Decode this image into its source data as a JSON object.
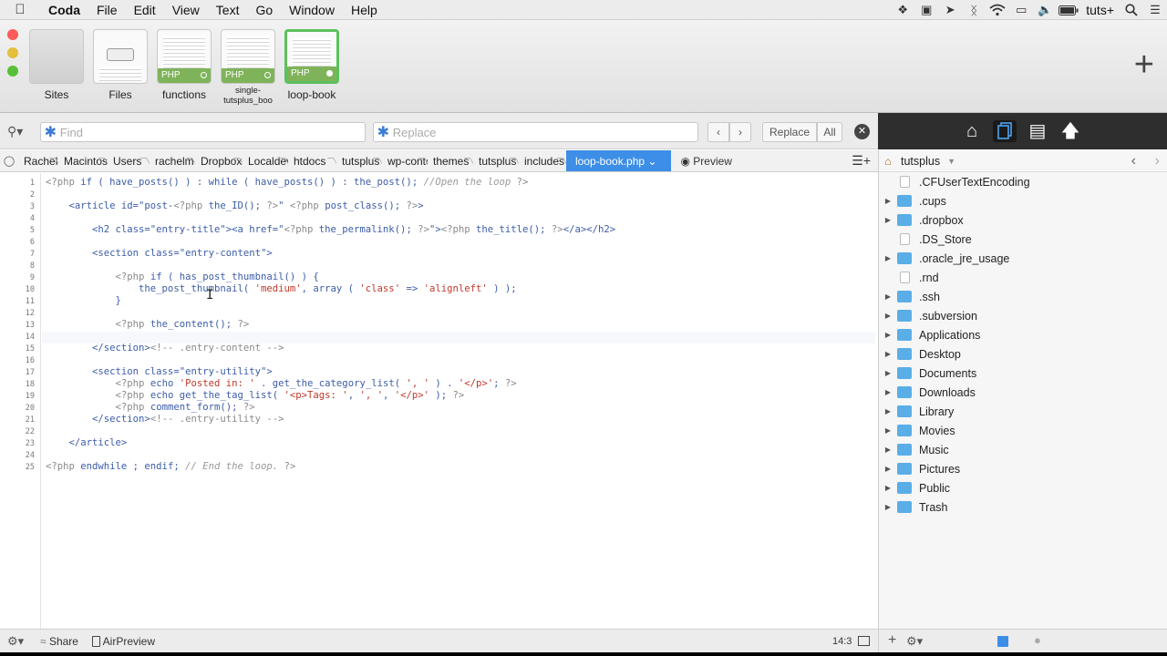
{
  "menubar": {
    "app": "Coda",
    "items": [
      "File",
      "Edit",
      "View",
      "Text",
      "Go",
      "Window",
      "Help"
    ],
    "user": "tuts+"
  },
  "sites": [
    {
      "label": "Sites"
    },
    {
      "label": "Files"
    },
    {
      "label": "functions",
      "badge": "PHP"
    },
    {
      "label": "single-tutsplus_boo",
      "badge": "PHP"
    },
    {
      "label": "loop-book",
      "badge": "PHP"
    }
  ],
  "find": {
    "placeholder": "Find",
    "replace_placeholder": "Replace",
    "replace_btn": "Replace",
    "all_btn": "All"
  },
  "path": [
    "Rachel's",
    "Macintosh",
    "Users",
    "rachelm",
    "Dropbox",
    "Localdev",
    "htdocs",
    "tutsplus",
    "wp-content",
    "themes",
    "tutsplus",
    "includes"
  ],
  "active_tab": "loop-book.php",
  "preview": "Preview",
  "code": [
    "<?php if ( have_posts() ) : while ( have_posts() ) : the_post(); //Open the loop ?>",
    "",
    "    <article id=\"post-<?php the_ID(); ?>\" <?php post_class(); ?>>",
    "",
    "        <h2 class=\"entry-title\"><a href=\"<?php the_permalink(); ?>\"><?php the_title(); ?></a></h2>",
    "",
    "        <section class=\"entry-content\">",
    "",
    "            <?php if ( has_post_thumbnail() ) {",
    "                the_post_thumbnail( 'medium', array ( 'class' => 'alignleft' ) );",
    "            }",
    "",
    "            <?php the_content(); ?>",
    "",
    "        </section><!-- .entry-content -->",
    "",
    "        <section class=\"entry-utility\">",
    "            <?php echo 'Posted in: ' . get_the_category_list( ', ' ) . '</p>'; ?>",
    "            <?php echo get_the_tag_list( '<p>Tags: ', ', ', '</p>' ); ?>",
    "            <?php comment_form(); ?>",
    "        </section><!-- .entry-utility -->",
    "",
    "    </article>",
    "",
    "<?php endwhile ; endif; // End the loop. ?>"
  ],
  "files": {
    "root": "tutsplus",
    "items": [
      {
        "name": ".CFUserTextEncoding",
        "type": "file"
      },
      {
        "name": ".cups",
        "type": "folder"
      },
      {
        "name": ".dropbox",
        "type": "folder"
      },
      {
        "name": ".DS_Store",
        "type": "file"
      },
      {
        "name": ".oracle_jre_usage",
        "type": "folder"
      },
      {
        "name": ".rnd",
        "type": "file"
      },
      {
        "name": ".ssh",
        "type": "folder"
      },
      {
        "name": ".subversion",
        "type": "folder"
      },
      {
        "name": "Applications",
        "type": "folder"
      },
      {
        "name": "Desktop",
        "type": "folder"
      },
      {
        "name": "Documents",
        "type": "folder"
      },
      {
        "name": "Downloads",
        "type": "folder"
      },
      {
        "name": "Library",
        "type": "folder"
      },
      {
        "name": "Movies",
        "type": "folder"
      },
      {
        "name": "Music",
        "type": "folder"
      },
      {
        "name": "Pictures",
        "type": "folder"
      },
      {
        "name": "Public",
        "type": "folder"
      },
      {
        "name": "Trash",
        "type": "folder"
      }
    ]
  },
  "bottom": {
    "share": "Share",
    "airpreview": "AirPreview",
    "cursor": "14:3"
  },
  "colors": {
    "accent": "#3d8ee7",
    "php_badge": "#7fb35a",
    "folder": "#5aaee7"
  }
}
